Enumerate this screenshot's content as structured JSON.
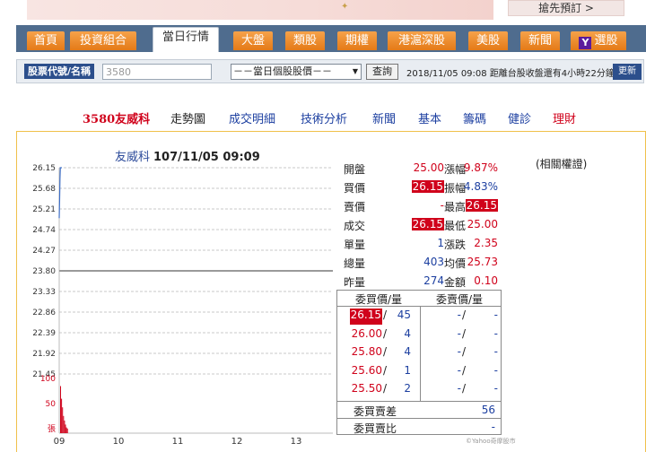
{
  "banner": {
    "button_label": "搶先預訂 >"
  },
  "nav": {
    "tabs": [
      {
        "label": "首頁"
      },
      {
        "label": "投資組合"
      },
      {
        "label": "當日行情"
      },
      {
        "label": "大盤"
      },
      {
        "label": "類股"
      },
      {
        "label": "期權"
      },
      {
        "label": "港滬深股"
      },
      {
        "label": "美股"
      },
      {
        "label": "新聞"
      },
      {
        "label": "選股"
      }
    ],
    "yahoo_icon": "Y"
  },
  "search": {
    "label": "股票代號/名稱",
    "value": "3580",
    "select_value": "－－當日個股股價－－",
    "go_label": "查詢",
    "status": "2018/11/05 09:08 距離台股收盤還有4小時22分鐘",
    "refresh_label": "更新"
  },
  "subnav": {
    "stock": "3580友威科",
    "items": [
      {
        "label": "走勢圖"
      },
      {
        "label": "成交明細"
      },
      {
        "label": "技術分析"
      },
      {
        "label": "新聞"
      },
      {
        "label": "基本"
      },
      {
        "label": "籌碼"
      },
      {
        "label": "健診"
      },
      {
        "label": "理財"
      }
    ]
  },
  "chart": {
    "name": "友威科",
    "datetime": "107/11/05 09:09",
    "related": "(相關權證)",
    "copyright": "©Yahoo奇摩股市"
  },
  "quote": {
    "rows": [
      {
        "l1": "開盤",
        "v1": "25.00",
        "l2": "漲幅",
        "v2": "9.87%"
      },
      {
        "l1": "買價",
        "v1": "26.15",
        "l2": "振幅",
        "v2": "4.83%"
      },
      {
        "l1": "賣價",
        "v1": "-",
        "l2": "最高",
        "v2": "26.15"
      },
      {
        "l1": "成交",
        "v1": "26.15",
        "l2": "最低",
        "v2": "25.00"
      },
      {
        "l1": "單量",
        "v1": "1",
        "l2": "漲跌",
        "v2": "2.35"
      },
      {
        "l1": "總量",
        "v1": "403",
        "l2": "均價",
        "v2": "25.73"
      },
      {
        "l1": "昨量",
        "v1": "274",
        "l2": "金額",
        "v2": "0.10"
      }
    ]
  },
  "book": {
    "bid_header": "委買價/量",
    "ask_header": "委賣價/量",
    "bids": [
      {
        "price": "26.15",
        "qty": "45"
      },
      {
        "price": "26.00",
        "qty": "4"
      },
      {
        "price": "25.80",
        "qty": "4"
      },
      {
        "price": "25.60",
        "qty": "1"
      },
      {
        "price": "25.50",
        "qty": "2"
      }
    ],
    "asks": [
      {
        "price": "-",
        "qty": "-"
      },
      {
        "price": "-",
        "qty": "-"
      },
      {
        "price": "-",
        "qty": "-"
      },
      {
        "price": "-",
        "qty": "-"
      },
      {
        "price": "-",
        "qty": "-"
      }
    ],
    "diff_label": "委買賣差",
    "diff_value": "56",
    "ratio_label": "委買賣比",
    "ratio_value": "-"
  },
  "chart_data": {
    "type": "line",
    "title": "友威科 107/11/05 09:09",
    "price_ticks": [
      "26.15",
      "25.68",
      "25.21",
      "24.74",
      "24.27",
      "23.80",
      "23.33",
      "22.86",
      "22.39",
      "21.92",
      "21.45"
    ],
    "ylim": [
      21.45,
      26.15
    ],
    "reference_price": 23.8,
    "x_ticks": [
      "09",
      "10",
      "11",
      "12",
      "13"
    ],
    "volume_ticks": [
      "100",
      "50",
      "張"
    ],
    "volume_max": 100,
    "series": [
      {
        "name": "price",
        "x": [
          0,
          0.4,
          0.8,
          1.2,
          1.6,
          2.0,
          2.4,
          2.8
        ],
        "values": [
          25.0,
          25.4,
          25.9,
          26.15,
          26.15,
          26.15,
          26.15,
          26.15
        ]
      },
      {
        "name": "volume",
        "x": [
          0.2,
          0.6,
          1.0,
          1.4,
          1.8,
          2.2,
          2.6,
          3.0
        ],
        "values": [
          82,
          60,
          45,
          30,
          22,
          15,
          10,
          8
        ]
      }
    ]
  },
  "colors": {
    "accent": "#d0021b",
    "nav": "#4f6c8e",
    "tab": "#e47a17",
    "link": "#1c3fa0",
    "border": "#f0c14b"
  }
}
